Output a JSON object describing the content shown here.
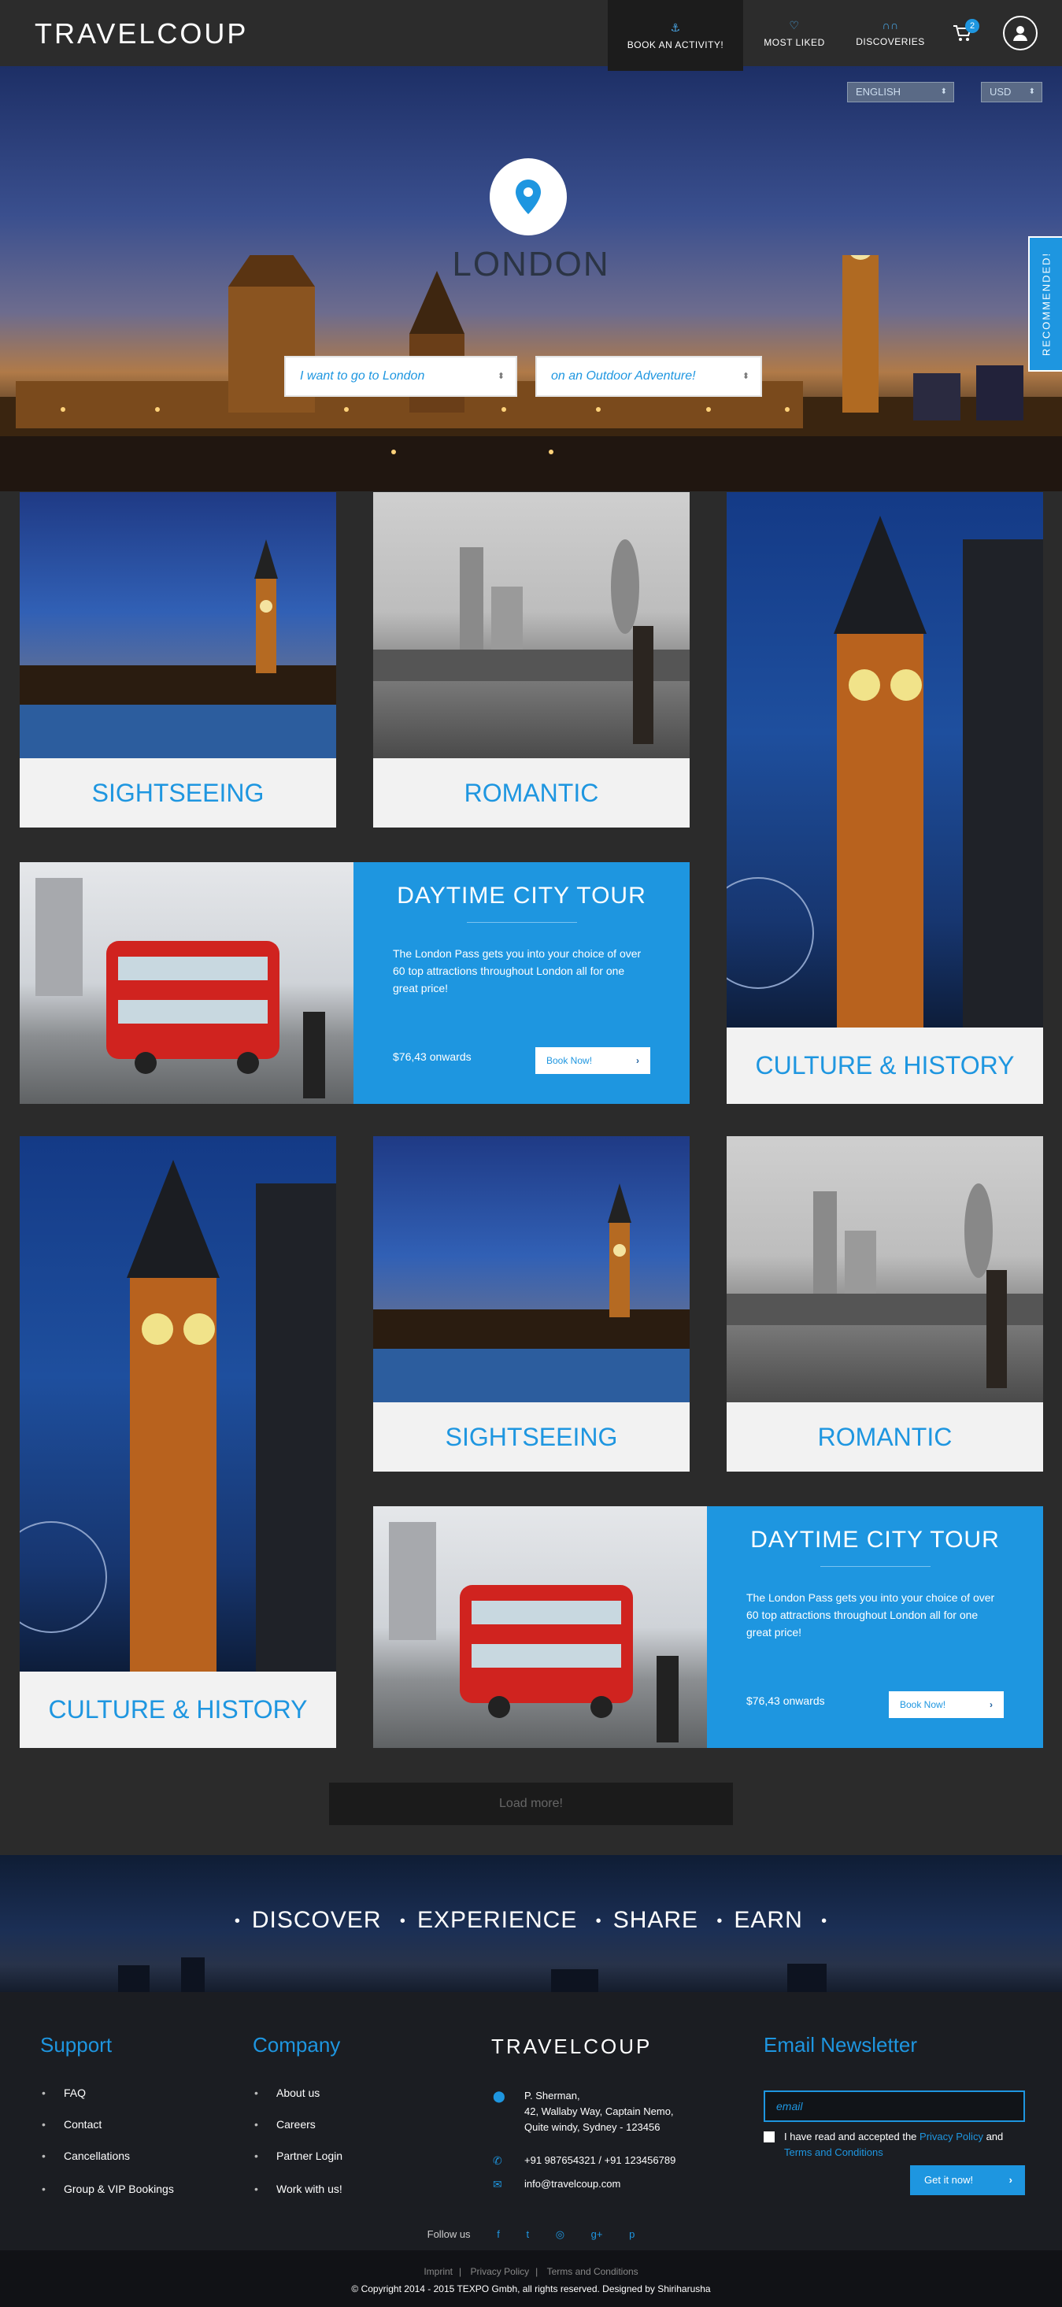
{
  "nav": {
    "logo": "TRAVELCOUP",
    "items": [
      {
        "label": "BOOK AN ACTIVITY!",
        "icon": "anchor-icon"
      },
      {
        "label": "MOST LIKED",
        "icon": "heart-icon"
      },
      {
        "label": "DISCOVERIES",
        "icon": "binoculars-icon"
      }
    ],
    "cart_count": "2"
  },
  "hero": {
    "language": "ENGLISH",
    "currency": "USD",
    "title": "LONDON",
    "dropdown_1": "I want to go to London",
    "dropdown_2": "on an Outdoor Adventure!",
    "recommended": "RECOMMENDED!"
  },
  "tiles": {
    "sightseeing": "SIGHTSEEING",
    "romantic": "ROMANTIC",
    "culture": "CULTURE & HISTORY"
  },
  "tour": {
    "title": "DAYTIME CITY TOUR",
    "description": "The London Pass gets you into your choice of over 60 top attractions throughout London all for one great price!",
    "price": "$76,43 onwards",
    "book_label": "Book Now!"
  },
  "load_more": "Load more!",
  "banner": {
    "words": [
      "DISCOVER",
      "EXPERIENCE",
      "SHARE",
      "EARN"
    ]
  },
  "footer": {
    "support": {
      "title": "Support",
      "links": [
        "FAQ",
        "Contact",
        "Cancellations",
        "Group & VIP Bookings"
      ]
    },
    "company": {
      "title": "Company",
      "links": [
        "About us",
        "Careers",
        "Partner Login",
        "Work with us!"
      ]
    },
    "logo": "TRAVELCOUP",
    "address": [
      "P. Sherman,",
      "42, Wallaby Way, Captain Nemo,",
      "Quite windy, Sydney - 123456"
    ],
    "phone": "+91 987654321  /  +91 123456789",
    "email": "info@travelcoup.com",
    "newsletter": {
      "title": "Email Newsletter",
      "placeholder": "email",
      "agree_prefix": "I have read and accepted the",
      "privacy": "Privacy Policy",
      "and": "and",
      "terms": "Terms and Conditions",
      "button": "Get it now!"
    },
    "follow": "Follow us",
    "bottom_links": [
      "Imprint",
      "Privacy Policy",
      "Terms and Conditions"
    ],
    "copyright": "© Copyright 2014 - 2015 TEXPO Gmbh, all rights reserved. Designed by Shiriharusha"
  },
  "colors": {
    "accent": "#1e96e0",
    "nav_bg": "#2c2c2c",
    "page_bg": "#2b2b2b",
    "footer_bg": "#1b1d22"
  }
}
